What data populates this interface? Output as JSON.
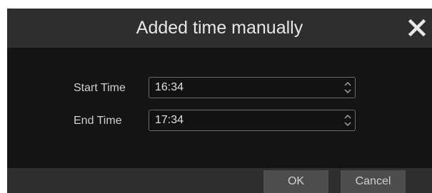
{
  "dialog": {
    "title": "Added time manually",
    "close_icon": "close-x-icon"
  },
  "form": {
    "start_label": "Start Time",
    "start_value": "16:34",
    "end_label": "End Time",
    "end_value": "17:34",
    "spinner_icon": "up-down-chevron-icon"
  },
  "footer": {
    "ok_label": "OK",
    "cancel_label": "Cancel"
  },
  "colors": {
    "titlebar": "#2e2e2e",
    "body": "#141414",
    "button": "#4d4d4d"
  }
}
